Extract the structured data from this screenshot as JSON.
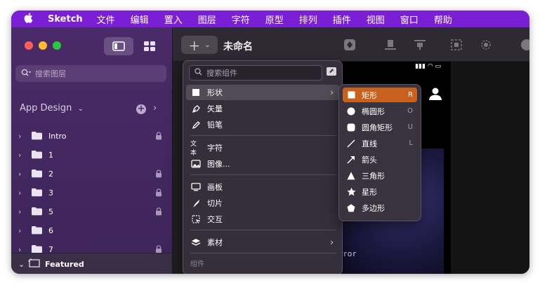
{
  "menubar": {
    "app_name": "Sketch",
    "items": [
      "文件",
      "编辑",
      "置入",
      "图层",
      "字符",
      "原型",
      "排列",
      "插件",
      "视图",
      "窗口",
      "帮助"
    ]
  },
  "sidebar": {
    "search_placeholder": "搜索图层",
    "page_name": "App Design",
    "layers": [
      {
        "name": "Intro",
        "locked": true
      },
      {
        "name": "1",
        "locked": false
      },
      {
        "name": "2",
        "locked": true
      },
      {
        "name": "3",
        "locked": true
      },
      {
        "name": "5",
        "locked": true
      },
      {
        "name": "6",
        "locked": false
      },
      {
        "name": "7",
        "locked": true
      }
    ],
    "featured_label": "Featured"
  },
  "toolbar": {
    "insert_icon": "plus-icon",
    "doc_title": "未命名"
  },
  "canvas": {
    "artboard_text": "rror"
  },
  "insert_menu": {
    "search_placeholder": "搜索组件",
    "items": [
      {
        "label": "形状",
        "icon": "shape-icon"
      },
      {
        "label": "矢量",
        "icon": "pen-icon"
      },
      {
        "label": "铅笔",
        "icon": "pencil-icon"
      },
      {
        "label": "字符",
        "icon": "text-icon",
        "icon_text": "文本"
      },
      {
        "label": "图像...",
        "icon": "image-icon"
      },
      {
        "label": "画板",
        "icon": "artboard-icon"
      },
      {
        "label": "切片",
        "icon": "slice-icon"
      },
      {
        "label": "交互",
        "icon": "hotspot-icon"
      },
      {
        "label": "素材",
        "icon": "layers-icon"
      }
    ],
    "section_label": "组件"
  },
  "shape_submenu": {
    "items": [
      {
        "label": "矩形",
        "key": "R"
      },
      {
        "label": "椭圆形",
        "key": "O"
      },
      {
        "label": "圆角矩形",
        "key": "U"
      },
      {
        "label": "直线",
        "key": "L"
      },
      {
        "label": "箭头",
        "key": ""
      },
      {
        "label": "三角形",
        "key": ""
      },
      {
        "label": "星形",
        "key": ""
      },
      {
        "label": "多边形",
        "key": ""
      }
    ]
  },
  "colors": {
    "menubar": "#7a1fd6",
    "sidebar": "#4a2a68",
    "selection": "#c9611e"
  }
}
